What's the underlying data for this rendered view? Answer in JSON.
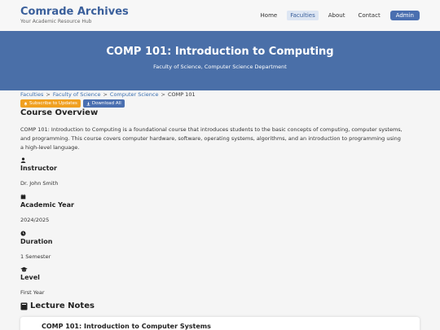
{
  "header": {
    "brand": "Comrade Archives",
    "tagline": "Your Academic Resource Hub",
    "nav": [
      {
        "label": "Home"
      },
      {
        "label": "Faculties"
      },
      {
        "label": "About"
      },
      {
        "label": "Contact"
      },
      {
        "label": "Admin"
      }
    ],
    "active_nav": "Faculties"
  },
  "hero": {
    "title": "COMP 101: Introduction to Computing",
    "subtitle": "Faculty of Science, Computer Science Department"
  },
  "breadcrumb": {
    "items": [
      "Faculties",
      "Faculty of Science",
      "Computer Science",
      "COMP 101"
    ],
    "separator": ">"
  },
  "actions": {
    "subscribe": "Subscribe to Updates",
    "download": "Download All"
  },
  "overview": {
    "heading": "Course Overview",
    "text": "COMP 101: Introduction to Computing is a foundational course that introduces students to the basic concepts of computing, computer systems, and programming. This course covers computer hardware, software, operating systems, algorithms, and an introduction to programming using a high-level language."
  },
  "details": {
    "instructor": {
      "label": "Instructor",
      "value": "Dr. John Smith",
      "icon": "user-icon"
    },
    "academic_year": {
      "label": "Academic Year",
      "value": "2024/2025",
      "icon": "calendar-icon"
    },
    "duration": {
      "label": "Duration",
      "value": "1 Semester",
      "icon": "clock-icon"
    },
    "level": {
      "label": "Level",
      "value": "First Year",
      "icon": "graduation-cap-icon"
    }
  },
  "lecture_notes": {
    "heading": "Lecture Notes",
    "items": [
      {
        "title": "COMP 101: Introduction to Computer Systems"
      }
    ]
  },
  "colors": {
    "brand": "#3a5f9b",
    "hero_bg": "#4a6fa8",
    "subscribe": "#f0a020",
    "primary": "#4a6fb0"
  }
}
